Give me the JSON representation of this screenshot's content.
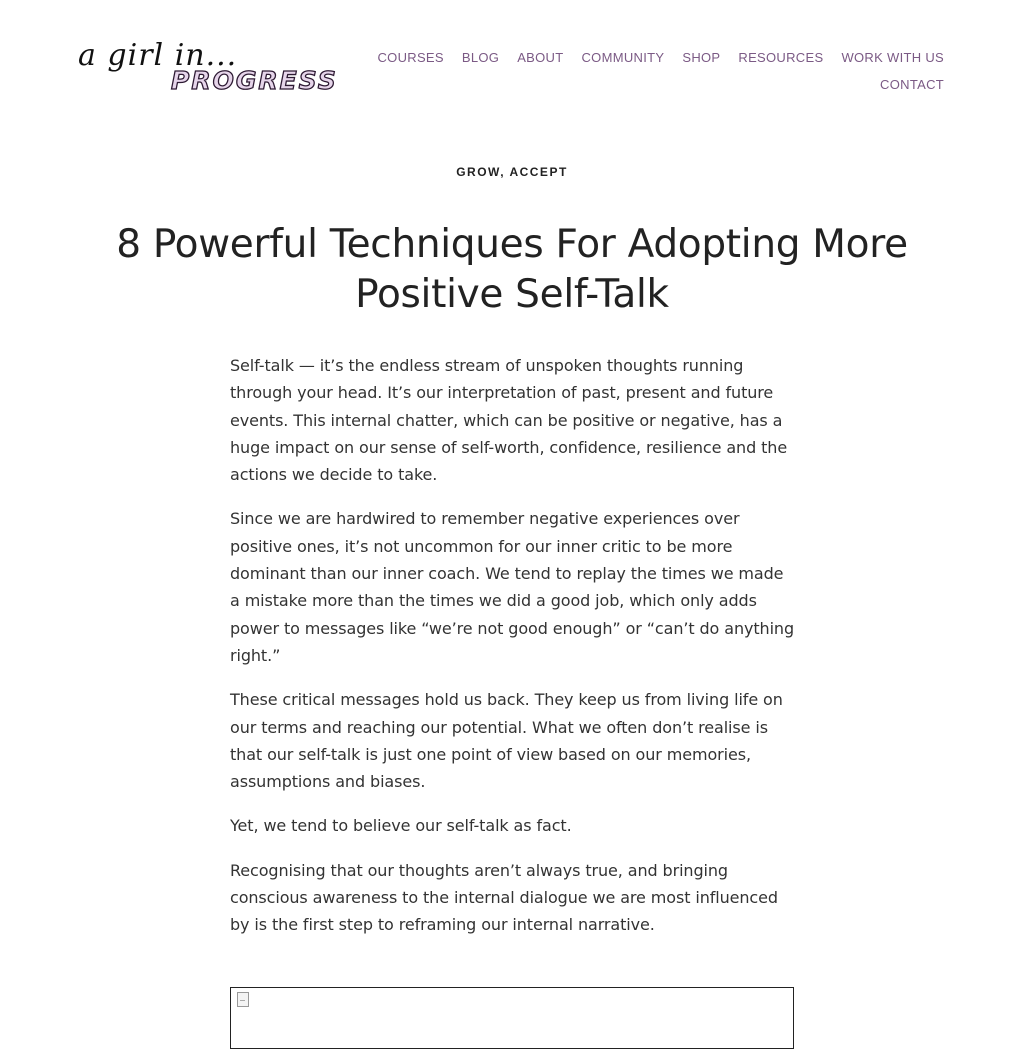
{
  "logo": {
    "script_text": "a girl in...",
    "wordmark": "PROGRESS"
  },
  "nav": {
    "items": [
      "COURSES",
      "BLOG",
      "ABOUT",
      "COMMUNITY",
      "SHOP",
      "RESOURCES",
      "WORK WITH US"
    ],
    "contact": "CONTACT",
    "color": "#7b5a85"
  },
  "post": {
    "categories": [
      "GROW",
      "ACCEPT"
    ],
    "category_separator": ", ",
    "title_line1": "8 Powerful Techniques For Adopting More",
    "title_line2": "Positive Self-Talk",
    "paragraphs": [
      "Self-talk — it’s the endless stream of unspoken thoughts running through your head. It’s our interpretation of past, present and future events. This internal chatter, which can be positive or negative, has a huge impact on our sense of self-worth, confidence, resilience and the actions we decide to take.",
      "Since we are hardwired to remember negative experiences over positive ones, it’s not uncommon for our inner critic to be more dominant than our inner coach. We tend to replay the times we made a mistake more than the times we did a good job, which only adds power to messages like “we’re not good enough” or “can’t do anything right.”",
      "These critical messages hold us back. They keep us from living life on our terms and reaching our potential.  What we often don’t realise is that our self-talk is just one point of view based on our memories, assumptions and biases.",
      "Yet, we tend to believe our self-talk as fact.",
      "Recognising that our thoughts aren’t always true, and bringing conscious awareness to the internal dialogue we are most influenced by is the first step to reframing our internal narrative."
    ]
  },
  "embed": {
    "icon": "broken-image-icon"
  }
}
